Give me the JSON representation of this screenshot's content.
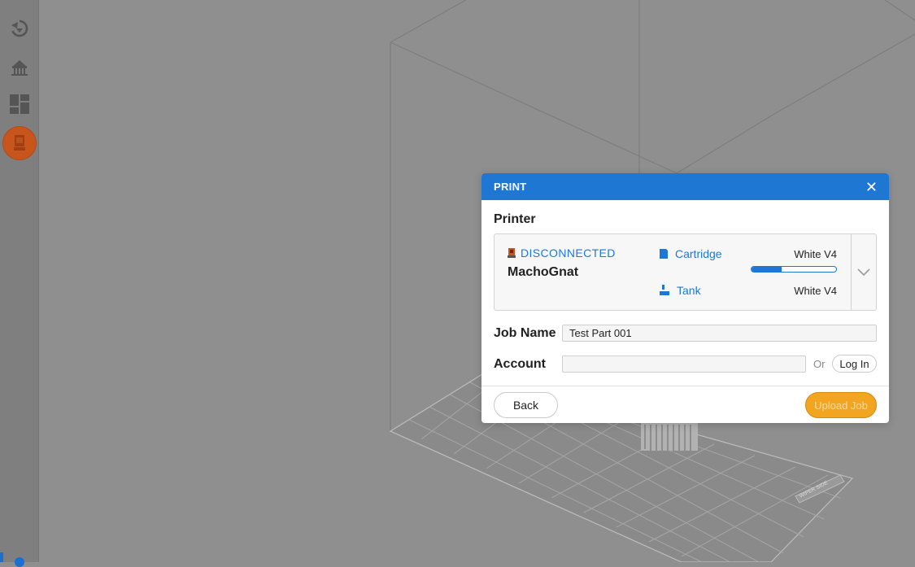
{
  "colors": {
    "accent": "#1f77d4",
    "active_tool": "#c8551c",
    "upload": "#f2a521"
  },
  "toolbar": {
    "items": [
      {
        "icon": "orient-icon"
      },
      {
        "icon": "supports-icon"
      },
      {
        "icon": "layout-icon"
      },
      {
        "icon": "printer-icon",
        "active": true
      }
    ]
  },
  "scene": {
    "plate_label": "WIPER SIDE"
  },
  "dialog": {
    "title": "PRINT",
    "close_icon": "✕",
    "printer_section_label": "Printer",
    "printer": {
      "status": "DISCONNECTED",
      "name": "MachoGnat",
      "cartridge_label": "Cartridge",
      "cartridge_value": "White V4",
      "cartridge_fill_fraction": 0.36,
      "tank_label": "Tank",
      "tank_value": "White V4"
    },
    "job_name_label": "Job Name",
    "job_name_value": "Test Part 001",
    "account_label": "Account",
    "account_value": "",
    "or_text": "Or",
    "login_label": "Log In",
    "back_label": "Back",
    "upload_label": "Upload Job"
  }
}
